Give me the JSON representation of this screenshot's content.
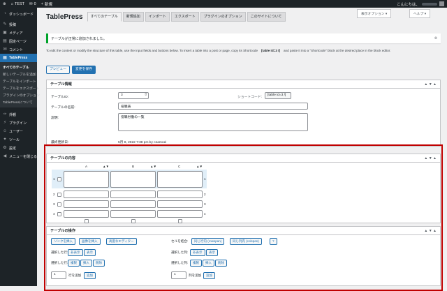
{
  "admin_bar": {
    "site": "TEST",
    "comments": "0",
    "new": "新規",
    "greeting": "こんにちは、"
  },
  "sidebar": {
    "items": [
      {
        "label": "ダッシュボード",
        "icon": "dashboard-icon"
      },
      {
        "label": "投稿",
        "icon": "pin-icon"
      },
      {
        "label": "メディア",
        "icon": "media-icon"
      },
      {
        "label": "固定ページ",
        "icon": "page-icon"
      },
      {
        "label": "コメント",
        "icon": "comment-icon"
      },
      {
        "label": "TablePress",
        "icon": "table-icon"
      }
    ],
    "sub": [
      "すべてのテーブル",
      "新しいテーブルを追加",
      "テーブルをインポート",
      "テーブルをエクスポート",
      "プラグインのオプション",
      "TablePressについて"
    ],
    "items2": [
      {
        "label": "外観",
        "icon": "brush-icon"
      },
      {
        "label": "プラグイン",
        "icon": "plugin-icon"
      },
      {
        "label": "ユーザー",
        "icon": "user-icon"
      },
      {
        "label": "ツール",
        "icon": "tool-icon"
      },
      {
        "label": "設定",
        "icon": "settings-icon"
      },
      {
        "label": "メニューを閉じる",
        "icon": "collapse-icon"
      }
    ]
  },
  "header": {
    "title": "TablePress",
    "tabs": [
      "すべてのテーブル",
      "新規追加",
      "インポート",
      "エクスポート",
      "プラグインのオプション",
      "このサイトについて"
    ],
    "screen_options": "表示オプション ▾",
    "help": "ヘルプ ▾"
  },
  "notice": "テーブルが正常に追加されました。",
  "instructions": {
    "text1": "To edit the content or modify the structure of this table, use the input fields and buttons below. To insert a table into a post or page, copy its Shortcode",
    "shortcode": "[table id=3 /]",
    "text2": "and paste it into a \"Shortcode\" block at the desired place in the block editor."
  },
  "actions": {
    "preview": "プレビュー",
    "save": "変更を保存"
  },
  "info_panel": {
    "title": "テーブル情報",
    "id_label": "テーブルID:",
    "id_value": "3",
    "shortcode_label": "ショートコード:",
    "shortcode_value": "[table id=3 /]",
    "name_label": "テーブルの名前:",
    "name_value": "役職表",
    "desc_label": "説明:",
    "desc_value": "役職労働の一覧",
    "modified_label": "最終更新日:",
    "modified_value": "5月 8, 2022 7:38 pm by cnamoei"
  },
  "content_panel": {
    "title": "テーブルの内容",
    "columns": [
      "A",
      "B",
      "C"
    ],
    "rows": [
      "1",
      "2",
      "3",
      "4"
    ]
  },
  "ops_panel": {
    "title": "テーブルの操作",
    "insert_link": "リンクを挿入",
    "insert_image": "画像を挿入",
    "advanced_editor": "高度なエディター",
    "combine_label": "セルを結合:",
    "rowspan": "同じ行内 (rowspan)",
    "colspan": "同じ列内 (colspan)",
    "help_btn": "?",
    "selected_rows": "選択した行:",
    "selected_cols": "選択した列:",
    "hide": "非表示",
    "show": "表示",
    "duplicate": "複製",
    "insert": "挿入",
    "delete": "削除",
    "add_rows_value": "1",
    "add_rows_text": "行を追加",
    "add_cols_value": "1",
    "add_cols_text": "列を追加",
    "add_btn": "追加"
  },
  "collapse_controls": "▲ ▼ ▲",
  "highlight_color": "#c00000"
}
